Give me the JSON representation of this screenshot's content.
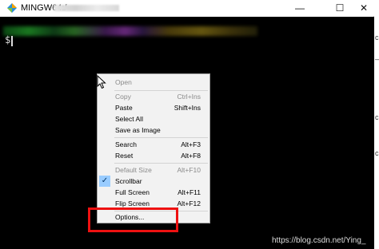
{
  "window": {
    "title": "MINGW64:/",
    "controls": {
      "minimize": "—",
      "maximize": "☐",
      "close": "✕"
    },
    "app_icon": "mingw-icon"
  },
  "terminal": {
    "prompt": "$",
    "background": "#000000"
  },
  "context_menu": {
    "items": [
      {
        "label": "Open",
        "shortcut": "",
        "disabled": true
      },
      {
        "label": "Copy",
        "shortcut": "Ctrl+Ins",
        "disabled": true
      },
      {
        "label": "Paste",
        "shortcut": "Shift+Ins",
        "disabled": false
      },
      {
        "label": "Select All",
        "shortcut": "",
        "disabled": false
      },
      {
        "label": "Save as Image",
        "shortcut": "",
        "disabled": false
      },
      {
        "label": "Search",
        "shortcut": "Alt+F3",
        "disabled": false
      },
      {
        "label": "Reset",
        "shortcut": "Alt+F8",
        "disabled": false
      },
      {
        "label": "Default Size",
        "shortcut": "Alt+F10",
        "disabled": true
      },
      {
        "label": "Scrollbar",
        "shortcut": "",
        "disabled": false,
        "checked": true
      },
      {
        "label": "Full Screen",
        "shortcut": "Alt+F11",
        "disabled": false
      },
      {
        "label": "Flip Screen",
        "shortcut": "Alt+F12",
        "disabled": false
      },
      {
        "label": "Options...",
        "shortcut": "",
        "disabled": false,
        "highlighted": true
      }
    ],
    "check_mark": "✓"
  },
  "highlight_color": "#ee1111",
  "watermark": "https://blog.csdn.net/Ying_"
}
